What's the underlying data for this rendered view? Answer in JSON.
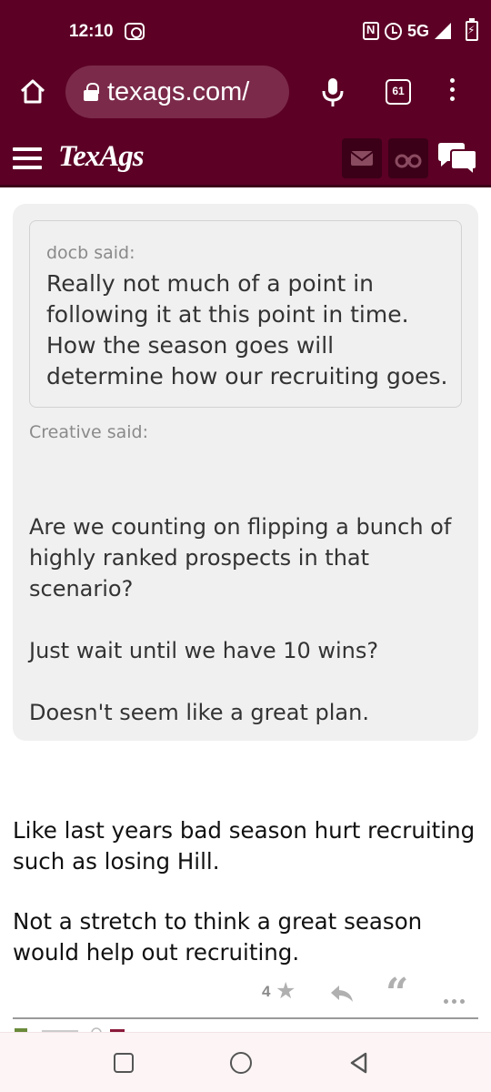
{
  "status_bar": {
    "time": "12:10",
    "network": "5G"
  },
  "browser": {
    "url": "texags.com/",
    "tab_count": "61"
  },
  "site": {
    "logo": "TexAgs"
  },
  "post": {
    "inner_quote": {
      "author_said": "docb said:",
      "text": "Really not much of a point in following it at this point in time. How the season goes will determine how our recruiting goes."
    },
    "outer_quote": {
      "author_said": "Creative said:",
      "paragraphs": [
        "Are we counting on flipping a bunch of highly ranked prospects in that scenario?",
        "Just wait until we have 10 wins?",
        "Doesn't seem like a great plan."
      ]
    },
    "reply_paragraphs": [
      "Like last years bad season hurt recruiting such as losing Hill.",
      "Not a stretch to think a great season would help out recruiting."
    ],
    "star_count": "4"
  },
  "colors": {
    "brand": "#5c0025",
    "quote_bg": "#f0f0f0"
  }
}
